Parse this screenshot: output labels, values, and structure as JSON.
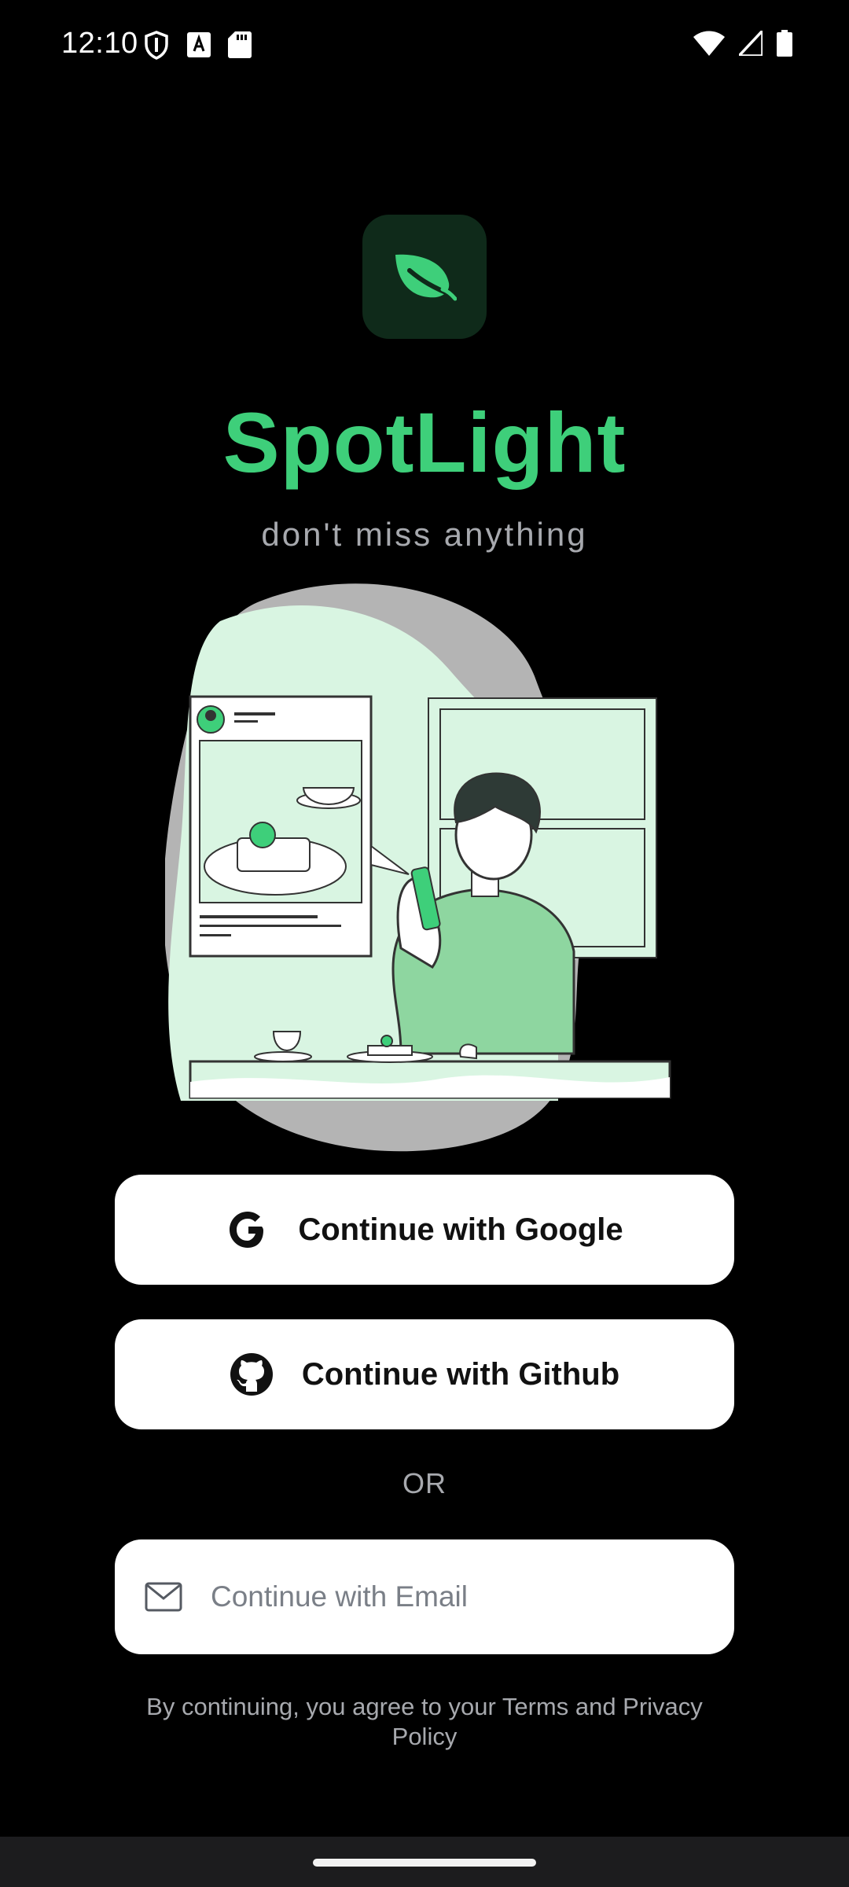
{
  "status_bar": {
    "time": "12:10",
    "left_icons": [
      "shield-icon",
      "keyboard-a-icon",
      "sd-card-icon"
    ],
    "right_icons": [
      "wifi-icon",
      "signal-icon",
      "battery-icon"
    ]
  },
  "app": {
    "logo_icon": "leaf-icon",
    "title": "SpotLight",
    "tagline": "don't miss anything",
    "accent_color": "#3ecf7a"
  },
  "illustration": "person-browsing-phone-illustration",
  "auth": {
    "google_label": "Continue with Google",
    "google_icon": "google-icon",
    "github_label": "Continue with Github",
    "github_icon": "github-icon",
    "divider_text": "OR",
    "email_placeholder": "Continue with Email",
    "email_icon": "mail-icon",
    "email_value": ""
  },
  "terms_text": "By continuing, you agree to your Terms and Privacy Policy"
}
